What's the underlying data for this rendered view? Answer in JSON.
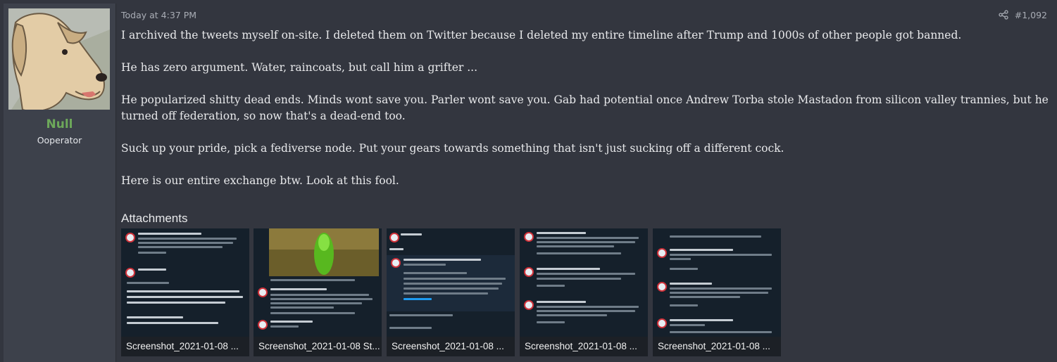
{
  "user": {
    "name": "Null",
    "title": "Ooperator"
  },
  "post": {
    "timestamp": "Today at 4:37 PM",
    "number": "#1,092",
    "paragraphs": [
      "I archived the tweets myself on-site. I deleted them on Twitter because I deleted my entire timeline after Trump and 1000s of other people got banned.",
      "He has zero argument. Water, raincoats, but call him a grifter ...",
      "He popularized shitty dead ends. Minds wont save you. Parler wont save you. Gab had potential once Andrew Torba stole Mastadon from silicon valley trannies, but he turned off federation, so now that's a dead-end too.",
      "Suck up your pride, pick a fediverse node. Put your gears towards something that isn't just sucking off a different cock.",
      "Here is our entire exchange btw. Look at this fool."
    ],
    "attachments_label": "Attachments",
    "attachments": [
      {
        "caption": "Screenshot_2021-01-08 ..."
      },
      {
        "caption": "Screenshot_2021-01-08 St..."
      },
      {
        "caption": "Screenshot_2021-01-08 ..."
      },
      {
        "caption": "Screenshot_2021-01-08 ..."
      },
      {
        "caption": "Screenshot_2021-01-08 ..."
      }
    ]
  },
  "icons": {
    "share": "share-icon",
    "avatar": "dog-avatar"
  },
  "colors": {
    "background": "#33363f",
    "username": "#6da85a",
    "text": "#e8e9eb",
    "muted": "#a9adb5"
  }
}
